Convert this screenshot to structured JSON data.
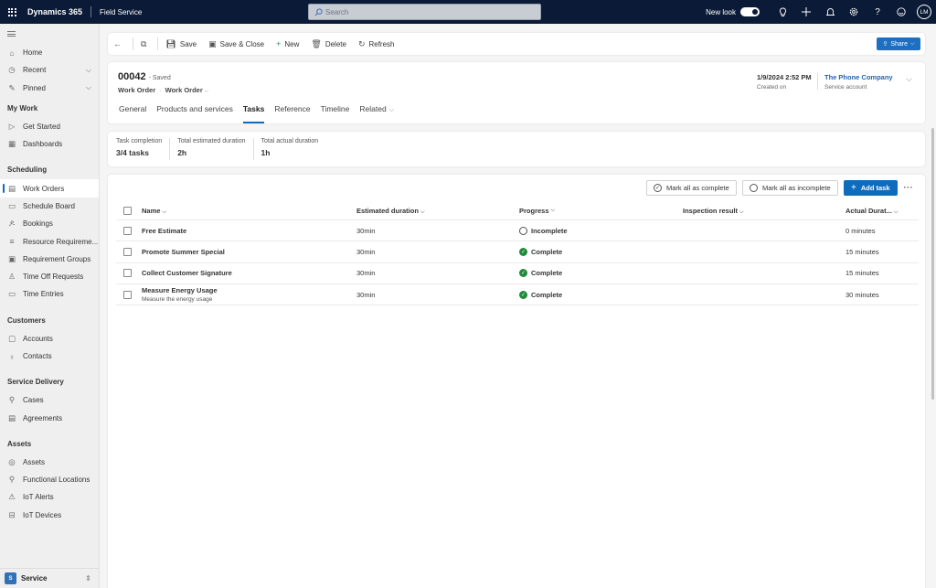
{
  "topbar": {
    "app_title": "Dynamics 365",
    "area_title": "Field Service",
    "search_placeholder": "Search",
    "new_look_label": "New look",
    "new_look_on": true,
    "icons": [
      "lightbulb-icon",
      "plus-icon",
      "bell-icon",
      "gear-icon",
      "help-icon",
      "smiley-icon"
    ],
    "user_initials": "LM"
  },
  "sidebar": {
    "top_items": [
      {
        "label": "Home",
        "icon": "home-icon"
      },
      {
        "label": "Recent",
        "icon": "clock-icon",
        "expandable": true
      },
      {
        "label": "Pinned",
        "icon": "pin-icon",
        "expandable": true
      }
    ],
    "groups": [
      {
        "title": "My Work",
        "items": [
          {
            "label": "Get Started",
            "icon": "play-icon"
          },
          {
            "label": "Dashboards",
            "icon": "dashboard-icon"
          }
        ]
      },
      {
        "title": "Scheduling",
        "items": [
          {
            "label": "Work Orders",
            "icon": "clipboard-icon",
            "active": true
          },
          {
            "label": "Schedule Board",
            "icon": "calendar-icon"
          },
          {
            "label": "Bookings",
            "icon": "people-icon"
          },
          {
            "label": "Resource Requireme...",
            "icon": "list-icon"
          },
          {
            "label": "Requirement Groups",
            "icon": "group-icon"
          },
          {
            "label": "Time Off Requests",
            "icon": "person-clock-icon"
          },
          {
            "label": "Time Entries",
            "icon": "calendar-icon"
          }
        ]
      },
      {
        "title": "Customers",
        "items": [
          {
            "label": "Accounts",
            "icon": "account-icon"
          },
          {
            "label": "Contacts",
            "icon": "person-icon"
          }
        ]
      },
      {
        "title": "Service Delivery",
        "items": [
          {
            "label": "Cases",
            "icon": "wrench-icon"
          },
          {
            "label": "Agreements",
            "icon": "document-icon"
          }
        ]
      },
      {
        "title": "Assets",
        "items": [
          {
            "label": "Assets",
            "icon": "asset-icon"
          },
          {
            "label": "Functional Locations",
            "icon": "location-icon"
          },
          {
            "label": "IoT Alerts",
            "icon": "iot-alert-icon"
          },
          {
            "label": "IoT Devices",
            "icon": "device-icon"
          }
        ]
      }
    ],
    "area_switcher": {
      "badge": "S",
      "label": "Service"
    }
  },
  "commandbar": {
    "back": "back-icon",
    "popout": "popout-icon",
    "buttons": [
      {
        "label": "Save",
        "icon": "save-icon"
      },
      {
        "label": "Save & Close",
        "icon": "save-close-icon"
      },
      {
        "label": "New",
        "icon": "plus-icon"
      },
      {
        "label": "Delete",
        "icon": "trash-icon"
      },
      {
        "label": "Refresh",
        "icon": "refresh-icon"
      }
    ],
    "share_label": "Share"
  },
  "record": {
    "title": "00042",
    "status": "- Saved",
    "entity": "Work Order",
    "form": "Work Order",
    "created_on_value": "1/9/2024 2:52 PM",
    "created_on_label": "Created on",
    "account_value": "The Phone Company",
    "account_label": "Service account",
    "tabs": [
      "General",
      "Products and services",
      "Tasks",
      "Reference",
      "Timeline",
      "Related"
    ],
    "active_tab": "Tasks"
  },
  "summary": [
    {
      "label": "Task completion",
      "value": "3/4 tasks"
    },
    {
      "label": "Total estimated duration",
      "value": "2h"
    },
    {
      "label": "Total actual duration",
      "value": "1h"
    }
  ],
  "tasks": {
    "mark_complete_label": "Mark all as complete",
    "mark_incomplete_label": "Mark all as incomplete",
    "add_task_label": "Add task",
    "columns": [
      "Name",
      "Estimated duration",
      "Progress",
      "Inspection result",
      "Actual Durat..."
    ],
    "rows": [
      {
        "name": "Free Estimate",
        "description": "",
        "estimated": "30min",
        "progress": "Incomplete",
        "inspection": "",
        "actual": "0 minutes"
      },
      {
        "name": "Promote Summer Special",
        "description": "",
        "estimated": "30min",
        "progress": "Complete",
        "inspection": "",
        "actual": "15 minutes"
      },
      {
        "name": "Collect Customer Signature",
        "description": "",
        "estimated": "30min",
        "progress": "Complete",
        "inspection": "",
        "actual": "15 minutes"
      },
      {
        "name": "Measure Energy Usage",
        "description": "Measure the energy usage",
        "estimated": "30min",
        "progress": "Complete",
        "inspection": "",
        "actual": "30 minutes"
      }
    ]
  },
  "colors": {
    "topbar": "#0b1a36",
    "accent": "#0f6cbd",
    "complete": "#1f8a3a",
    "link": "#2266b3"
  }
}
